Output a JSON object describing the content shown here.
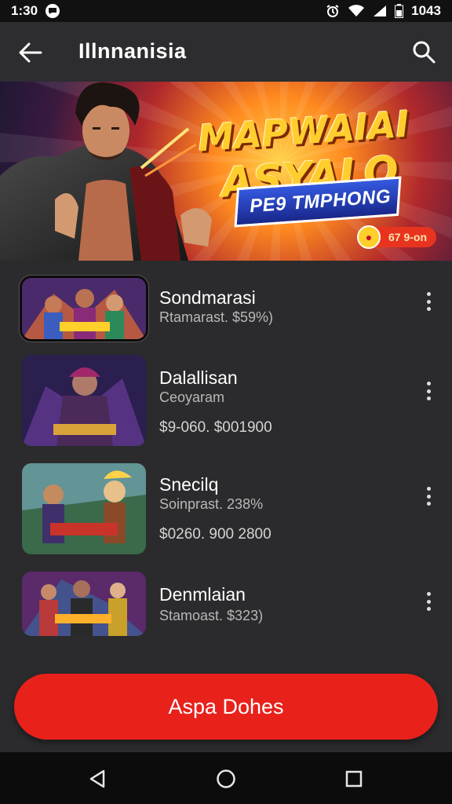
{
  "status_bar": {
    "time": "1:30",
    "battery_text": "1043",
    "icons": [
      "message-icon",
      "alarm-icon",
      "wifi-icon",
      "signal-icon",
      "battery-icon"
    ]
  },
  "app_bar": {
    "title": "Illnnanisia",
    "back_icon": "arrow-left-icon",
    "search_icon": "search-icon"
  },
  "banner": {
    "title_line_1": "MAPWAIAI",
    "title_line_2": "ASYALO",
    "subtitle": "PE9 TMPHONG",
    "badge_text": "67 9-on",
    "badge_icon": "coin-icon",
    "colors": {
      "glow": "#ffd34a",
      "ribbon": "#2e4fd0",
      "badge": "#e8341f"
    }
  },
  "games": [
    {
      "name": "Sondmarasi",
      "meta": "Rtamarast. $59%)",
      "price": "",
      "selected": true
    },
    {
      "name": "Dalallisan",
      "meta": "Ceoyaram",
      "price": "$9-060. $001900",
      "selected": false
    },
    {
      "name": "Snecilq",
      "meta": "Soinprast. 238%",
      "price": "$0260. 900 2800",
      "selected": false
    },
    {
      "name": "Denmlaian",
      "meta": "Stamoast. $323)",
      "price": "",
      "selected": false
    }
  ],
  "primary_button": {
    "label": "Aspa Dohes",
    "color": "#e8211b"
  },
  "nav_bar": {
    "icons": [
      "back-triangle-icon",
      "home-circle-icon",
      "recents-square-icon"
    ]
  }
}
